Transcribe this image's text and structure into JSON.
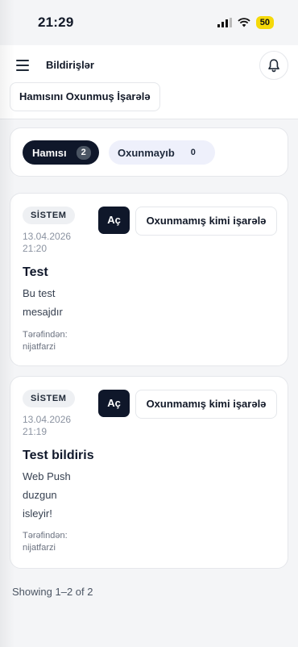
{
  "status_bar": {
    "time": "21:29",
    "battery": "50"
  },
  "header": {
    "title": "Bildirişlər",
    "mark_all_label": "Hamısını Oxunmuş İşarələ"
  },
  "tabs": [
    {
      "label": "Hamısı",
      "count": "2",
      "active": true
    },
    {
      "label": "Oxunmayıb",
      "count": "0",
      "active": false
    }
  ],
  "notifications": [
    {
      "badge": "SİSTEM",
      "date": "13.04.2026 21:20",
      "open_label": "Aç",
      "mark_unread_label": "Oxunmamış kimi işarələ",
      "title": "Test",
      "body": "Bu test mesajdır",
      "author": "Tərəfindən: nijatfarzi"
    },
    {
      "badge": "SİSTEM",
      "date": "13.04.2026 21:19",
      "open_label": "Aç",
      "mark_unread_label": "Oxunmamış kimi işarələ",
      "title": "Test bildiris",
      "body": "Web Push duzgun isleyir!",
      "author": "Tərəfindən: nijatfarzi"
    }
  ],
  "pagination": {
    "text": "Showing 1–2 of 2"
  },
  "colors": {
    "primary": "#0f172a",
    "battery": "#f5d90a",
    "tab_inactive_bg": "#eef0fb"
  },
  "icons": {
    "menu": "hamburger-menu-icon",
    "notifications": "bell-icon",
    "signal": "cellular-signal-icon",
    "wifi": "wifi-icon"
  }
}
